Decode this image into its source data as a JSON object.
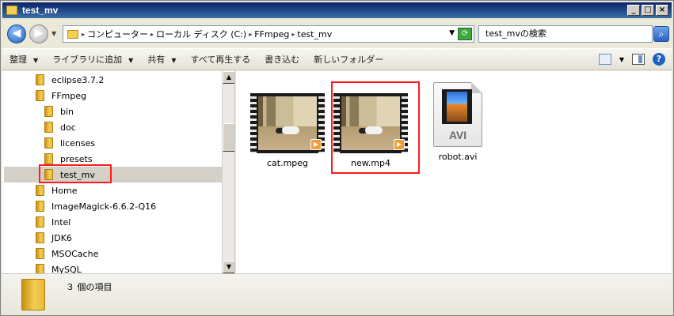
{
  "window": {
    "title": "test_mv"
  },
  "address": {
    "crumbs": [
      "コンピューター",
      "ローカル ディスク (C:)",
      "FFmpeg",
      "test_mv"
    ],
    "search_placeholder": "test_mvの検索"
  },
  "toolbar": {
    "organize": "整理",
    "add_to_library": "ライブラリに追加",
    "share": "共有",
    "play_all": "すべて再生する",
    "burn": "書き込む",
    "new_folder": "新しいフォルダー"
  },
  "nav": {
    "items": [
      "eclipse3.7.2",
      "FFmpeg",
      "bin",
      "doc",
      "licenses",
      "presets",
      "test_mv",
      "Home",
      "ImageMagick-6.6.2-Q16",
      "Intel",
      "JDK6",
      "MSOCache",
      "MySQL"
    ],
    "selected": "test_mv"
  },
  "files": [
    {
      "name": "cat.mpeg",
      "type": "video-thumbnail"
    },
    {
      "name": "new.mp4",
      "type": "video-thumbnail"
    },
    {
      "name": "robot.avi",
      "type": "avi-document",
      "badge": "AVI"
    }
  ],
  "details": {
    "count_text": "３ 個の項目"
  },
  "colors": {
    "highlight": "#ff1b1b",
    "titlebar": "#0a246a"
  }
}
